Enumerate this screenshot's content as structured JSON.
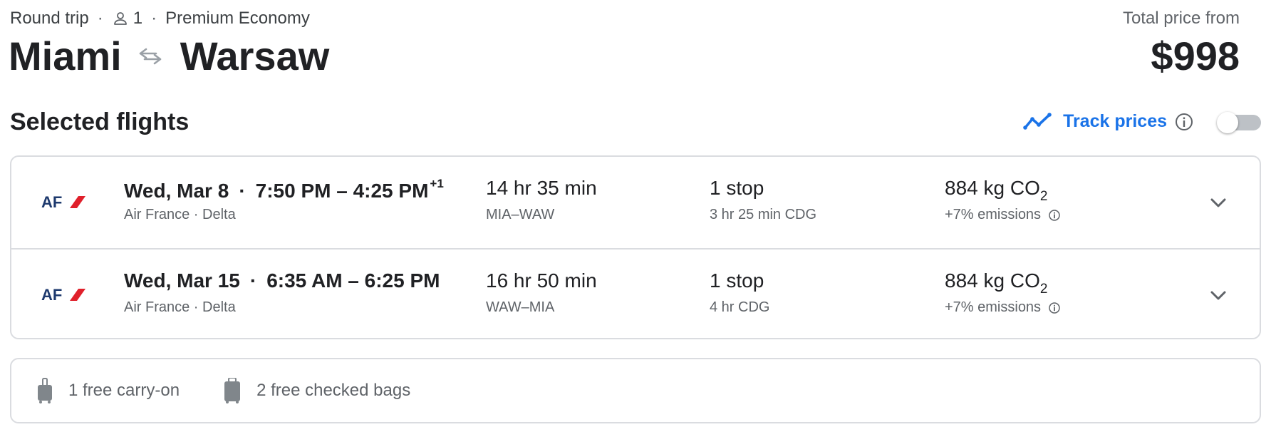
{
  "header": {
    "trip_type": "Round trip",
    "passengers": "1",
    "cabin": "Premium Economy",
    "origin": "Miami",
    "destination": "Warsaw",
    "price_label": "Total price from",
    "price": "$998"
  },
  "section_title": "Selected flights",
  "track": {
    "label": "Track prices",
    "enabled": false,
    "accent": "#1a73e8"
  },
  "flights": [
    {
      "logo": "AF",
      "date": "Wed, Mar 8",
      "times": "7:50 PM – 4:25 PM",
      "day_offset": "+1",
      "airlines": "Air France · Delta",
      "duration": "14 hr 35 min",
      "route": "MIA–WAW",
      "stops": "1 stop",
      "layover": "3 hr 25 min CDG",
      "emissions": "884 kg CO",
      "emissions_sub": "2",
      "emissions_note": "+7% emissions"
    },
    {
      "logo": "AF",
      "date": "Wed, Mar 15",
      "times": "6:35 AM – 6:25 PM",
      "day_offset": "",
      "airlines": "Air France · Delta",
      "duration": "16 hr 50 min",
      "route": "WAW–MIA",
      "stops": "1 stop",
      "layover": "4 hr CDG",
      "emissions": "884 kg CO",
      "emissions_sub": "2",
      "emissions_note": "+7% emissions"
    }
  ],
  "bags": {
    "carry_on": "1 free carry-on",
    "checked": "2 free checked bags"
  }
}
